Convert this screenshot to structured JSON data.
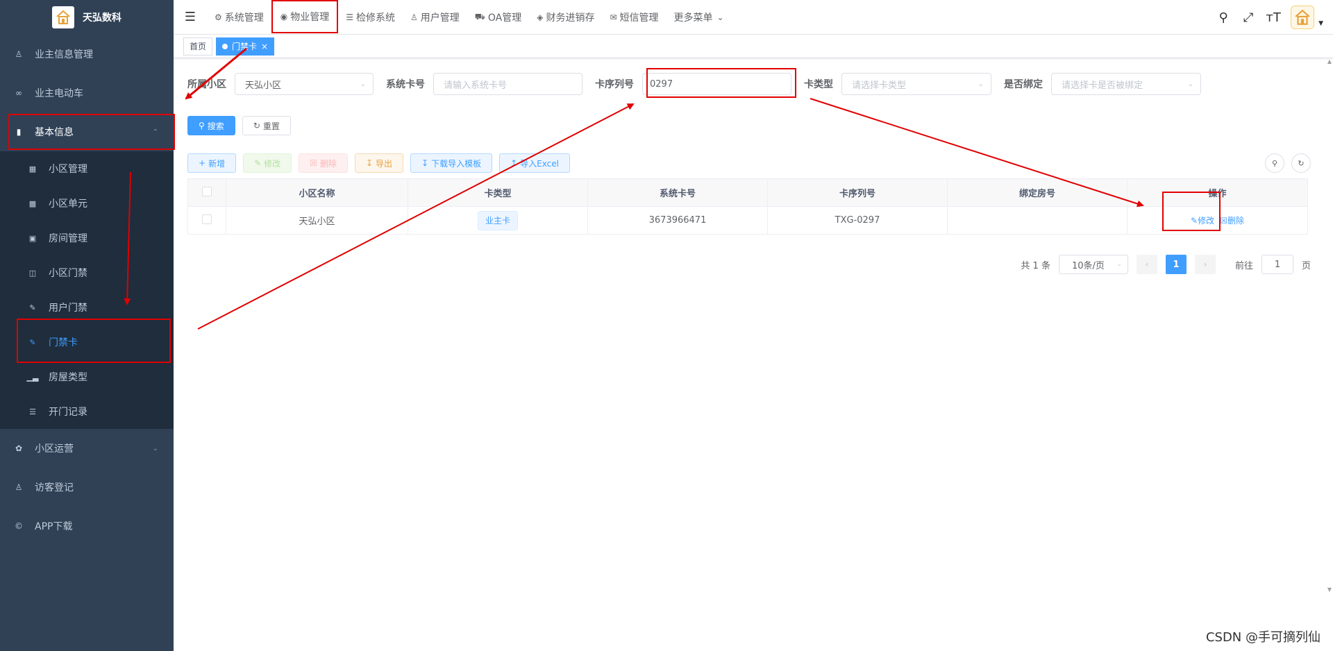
{
  "app": {
    "title": "天弘数科"
  },
  "sidebar": {
    "items": [
      {
        "label": "业主信息管理",
        "icon": "user-icon"
      },
      {
        "label": "业主电动车",
        "icon": "bike-icon"
      },
      {
        "label": "基本信息",
        "icon": "document-icon",
        "expanded": true
      },
      {
        "label": "小区运营",
        "icon": "ops-icon"
      },
      {
        "label": "访客登记",
        "icon": "visitor-icon"
      },
      {
        "label": "APP下载",
        "icon": "copyright-icon"
      }
    ],
    "submenu": [
      {
        "label": "小区管理",
        "icon": "grid-icon"
      },
      {
        "label": "小区单元",
        "icon": "unit-icon"
      },
      {
        "label": "房间管理",
        "icon": "film-icon"
      },
      {
        "label": "小区门禁",
        "icon": "book-icon"
      },
      {
        "label": "用户门禁",
        "icon": "edit-icon"
      },
      {
        "label": "门禁卡",
        "icon": "card-icon",
        "active": true
      },
      {
        "label": "房屋类型",
        "icon": "bar-chart-icon"
      },
      {
        "label": "开门记录",
        "icon": "log-icon"
      }
    ]
  },
  "topnav": {
    "items": [
      {
        "label": "系统管理",
        "icon": "gear-icon"
      },
      {
        "label": "物业管理",
        "icon": "globe-icon",
        "current": true
      },
      {
        "label": "检修系统",
        "icon": "tree-icon"
      },
      {
        "label": "用户管理",
        "icon": "person-icon"
      },
      {
        "label": "OA管理",
        "icon": "org-icon"
      },
      {
        "label": "财务进销存",
        "icon": "layers-icon"
      },
      {
        "label": "短信管理",
        "icon": "message-icon"
      },
      {
        "label": "更多菜单",
        "icon": "chevron-down-icon"
      }
    ]
  },
  "tags": {
    "home": "首页",
    "current": "门禁卡",
    "close": "×"
  },
  "filters": {
    "community_label": "所属小区",
    "community_value": "天弘小区",
    "sys_card_label": "系统卡号",
    "sys_card_placeholder": "请输入系统卡号",
    "serial_label": "卡序列号",
    "serial_value": "0297",
    "card_type_label": "卡类型",
    "card_type_placeholder": "请选择卡类型",
    "bound_label": "是否绑定",
    "bound_placeholder": "请选择卡是否被绑定",
    "search_btn": "搜索",
    "reset_btn": "重置"
  },
  "toolbar": {
    "add": "新增",
    "edit": "修改",
    "delete": "删除",
    "export": "导出",
    "download_template": "下载导入模板",
    "import_excel": "导入Excel"
  },
  "table": {
    "headers": [
      "小区名称",
      "卡类型",
      "系统卡号",
      "卡序列号",
      "绑定房号",
      "操作"
    ],
    "rows": [
      {
        "community": "天弘小区",
        "card_type": "业主卡",
        "sys_card": "3673966471",
        "serial": "TXG-0297",
        "room": "",
        "edit": "修改",
        "delete": "删除"
      }
    ]
  },
  "pagination": {
    "total": "共 1 条",
    "page_size": "10条/页",
    "current_page": "1",
    "goto_prefix": "前往",
    "goto_value": "1",
    "goto_suffix": "页"
  },
  "watermark": "CSDN @手可摘列仙",
  "colors": {
    "sidebar_bg": "#304156",
    "primary": "#409eff",
    "annotation_red": "#e10000"
  }
}
